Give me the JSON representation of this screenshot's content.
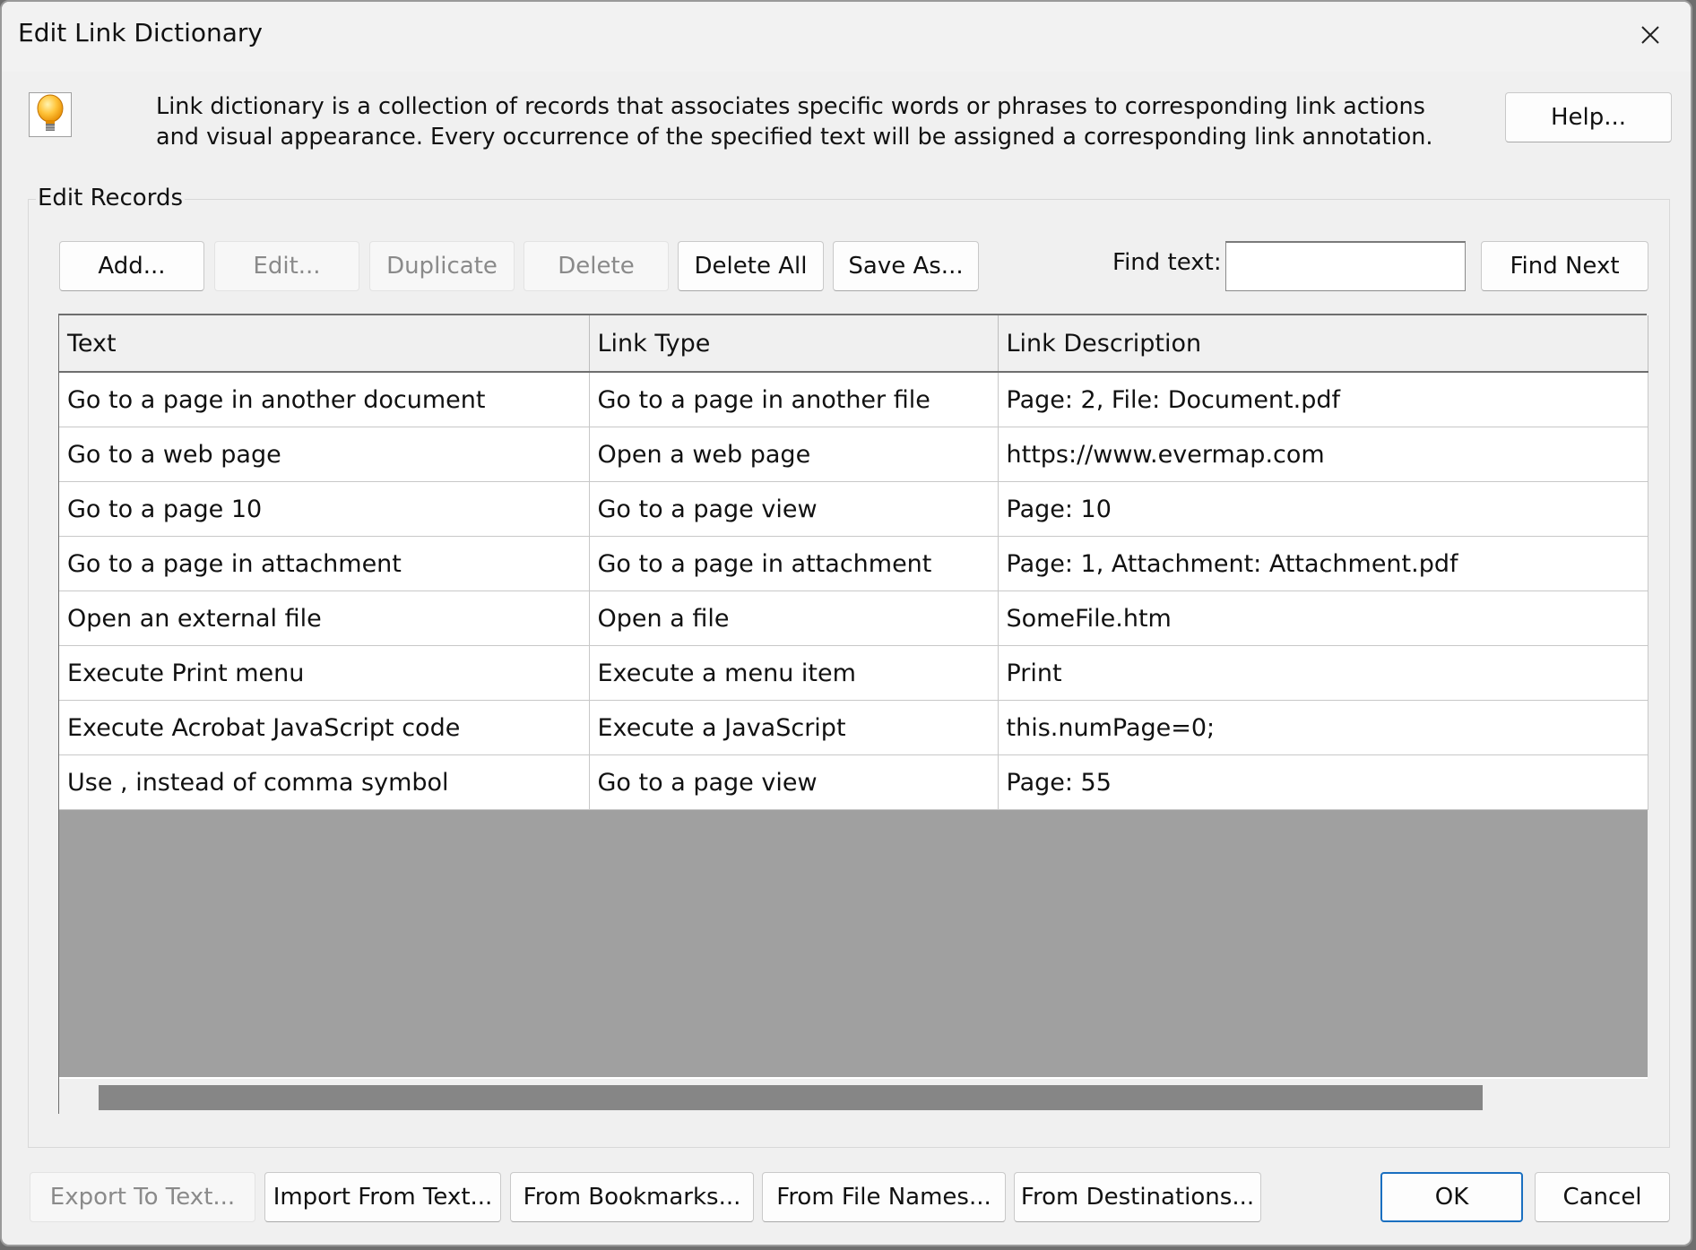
{
  "window": {
    "title": "Edit Link Dictionary",
    "close_icon": "close-icon"
  },
  "intro": {
    "icon": "lightbulb-icon",
    "text": "Link dictionary is a collection of records that associates specific words or phrases to corresponding link actions and visual appearance. Every occurrence of the specified text will be assigned a corresponding link annotation.",
    "help_label": "Help..."
  },
  "records": {
    "group_label": "Edit Records",
    "toolbar": {
      "add_label": "Add...",
      "edit_label": "Edit...",
      "duplicate_label": "Duplicate",
      "delete_label": "Delete",
      "delete_all_label": "Delete All",
      "save_as_label": "Save As..."
    },
    "find": {
      "label": "Find text:",
      "value": "",
      "placeholder": "",
      "find_next_label": "Find Next"
    },
    "table": {
      "columns": [
        "Text",
        "Link Type",
        "Link Description"
      ],
      "rows": [
        [
          "Go to a page in another document",
          "Go to a page in another file",
          "Page: 2, File: Document.pdf"
        ],
        [
          "Go to a web page",
          "Open a web page",
          "https://www.evermap.com"
        ],
        [
          "Go to a page 10",
          "Go to a page view",
          "Page: 10"
        ],
        [
          "Go to a page in attachment",
          "Go to a page in attachment",
          "Page: 1, Attachment: Attachment.pdf"
        ],
        [
          "Open an external file",
          "Open a file",
          "SomeFile.htm"
        ],
        [
          "Execute Print menu",
          "Execute a menu item",
          "Print"
        ],
        [
          "Execute Acrobat JavaScript code",
          "Execute a JavaScript",
          "this.numPage=0;"
        ],
        [
          "Use , instead of comma symbol",
          "Go to a page view",
          "Page: 55"
        ]
      ]
    }
  },
  "footer": {
    "export_label": "Export To Text...",
    "import_label": "Import From Text...",
    "from_bookmarks_label": "From Bookmarks...",
    "from_file_names_label": "From File Names...",
    "from_destinations_label": "From Destinations...",
    "ok_label": "OK",
    "cancel_label": "Cancel"
  },
  "colors": {
    "default_button_border": "#1a6fc0",
    "grid_empty_area": "#a0a0a0",
    "scrollbar_thumb": "#868686"
  }
}
